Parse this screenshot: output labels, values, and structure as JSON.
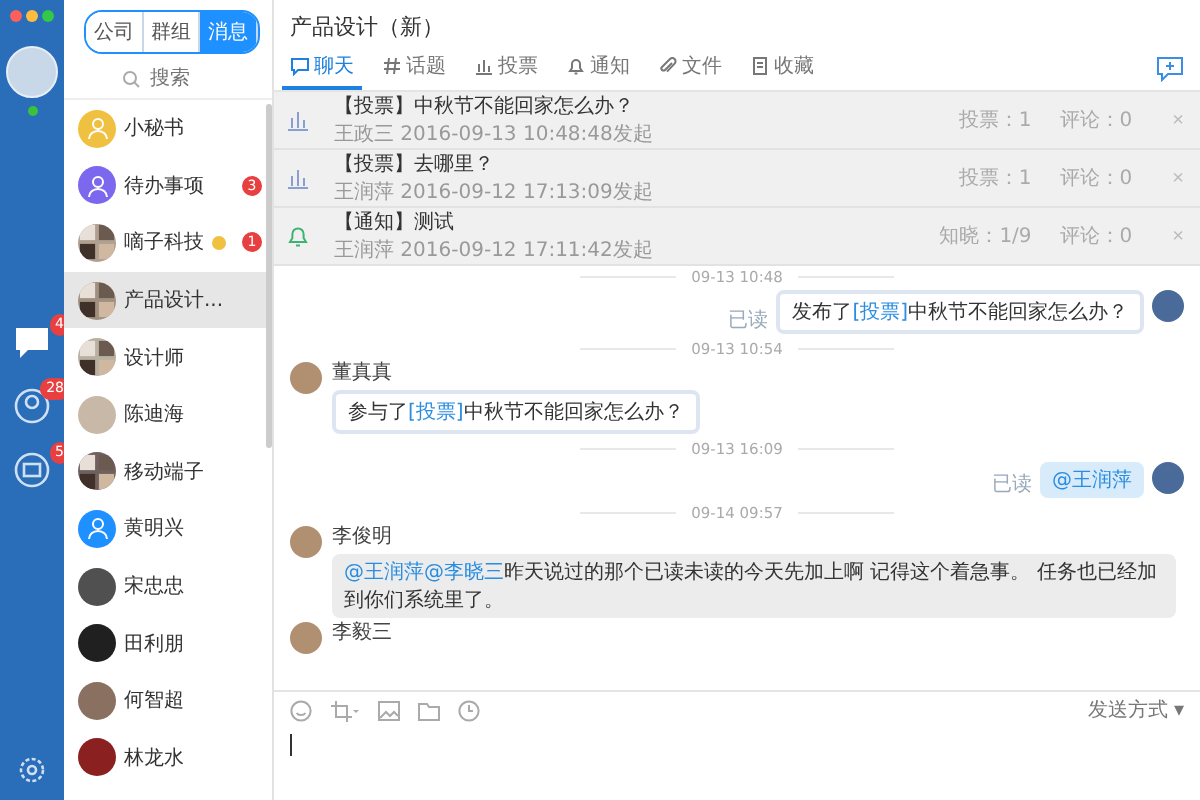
{
  "rail": {
    "badges": [
      "4",
      "28",
      "5"
    ]
  },
  "contact_tabs": [
    {
      "label": "公司",
      "selected": false
    },
    {
      "label": "群组",
      "selected": false
    },
    {
      "label": "消息",
      "selected": true
    }
  ],
  "search": {
    "placeholder": "搜索"
  },
  "contacts": [
    {
      "name": "小秘书",
      "kind": "icon",
      "color": "#f0c040",
      "selected": false
    },
    {
      "name": "待办事项",
      "kind": "icon",
      "color": "#7b68ee",
      "badge": "3",
      "selected": false
    },
    {
      "name": "嘀子科技",
      "kind": "group",
      "color": "#b0a090",
      "badge": "1",
      "verified": true,
      "selected": false
    },
    {
      "name": "产品设计...",
      "kind": "group",
      "color": "#a09080",
      "selected": true
    },
    {
      "name": "设计师",
      "kind": "group",
      "color": "#b8b0a0",
      "selected": false
    },
    {
      "name": "陈迪海",
      "kind": "photo",
      "color": "#c8b8a8",
      "selected": false
    },
    {
      "name": "移动端子",
      "kind": "group",
      "color": "#706060",
      "selected": false
    },
    {
      "name": "黄明兴",
      "kind": "icon",
      "color": "#1e90ff",
      "selected": false
    },
    {
      "name": "宋忠忠",
      "kind": "photo",
      "color": "#505050",
      "selected": false
    },
    {
      "name": "田利朋",
      "kind": "photo",
      "color": "#202020",
      "selected": false
    },
    {
      "name": "何智超",
      "kind": "photo",
      "color": "#8a7060",
      "selected": false
    },
    {
      "name": "林龙水",
      "kind": "photo",
      "color": "#8b2020",
      "selected": false
    }
  ],
  "chat": {
    "title": "产品设计（新）",
    "tabs": [
      {
        "label": "聊天",
        "kind": "chat",
        "selected": true
      },
      {
        "label": "话题",
        "kind": "topic",
        "selected": false
      },
      {
        "label": "投票",
        "kind": "vote",
        "selected": false
      },
      {
        "label": "通知",
        "kind": "notice",
        "selected": false
      },
      {
        "label": "文件",
        "kind": "file",
        "selected": false
      },
      {
        "label": "收藏",
        "kind": "favorite",
        "selected": false
      }
    ],
    "notices": [
      {
        "kind": "vote",
        "title": "【投票】中秋节不能回家怎么办？",
        "meta": "王政三 2016-09-13 10:48:48发起",
        "stat": "投票：1",
        "comments": "评论：0",
        "close": "×"
      },
      {
        "kind": "vote",
        "title": "【投票】去哪里？",
        "meta": "王润萍 2016-09-12 17:13:09发起",
        "stat": "投票：1",
        "comments": "评论：0",
        "close": "×"
      },
      {
        "kind": "notice",
        "title": "【通知】测试",
        "meta": "王润萍 2016-09-12 17:11:42发起",
        "stat": "知晓：1/9",
        "comments": "评论：0",
        "close": "×"
      }
    ],
    "messages": [
      {
        "kind": "divider",
        "text": "09-13 10:48"
      },
      {
        "kind": "outgoing",
        "prefix": "发布了",
        "link": "[投票]",
        "text": "中秋节不能回家怎么办？",
        "status": "已读"
      },
      {
        "kind": "divider",
        "text": "09-13 10:54"
      },
      {
        "kind": "incoming",
        "sender": "董真真",
        "prefix": "参与了",
        "link": "[投票]",
        "text": "中秋节不能回家怎么办？"
      },
      {
        "kind": "divider",
        "text": "09-13 16:09"
      },
      {
        "kind": "outgoing",
        "mentions": [
          "@王润萍"
        ],
        "status": "已读"
      },
      {
        "kind": "divider",
        "text": "09-14 09:57"
      },
      {
        "kind": "incoming",
        "sender": "李俊明",
        "mentions": [
          "@王润萍",
          "@李晓三"
        ],
        "text": "昨天说过的那个已读未读的今天先加上啊  记得这个着急事。  任务也已经加到你们系统里了。"
      },
      {
        "kind": "incoming",
        "sender": "李毅三"
      }
    ],
    "send_mode": "发送方式 ▾"
  }
}
